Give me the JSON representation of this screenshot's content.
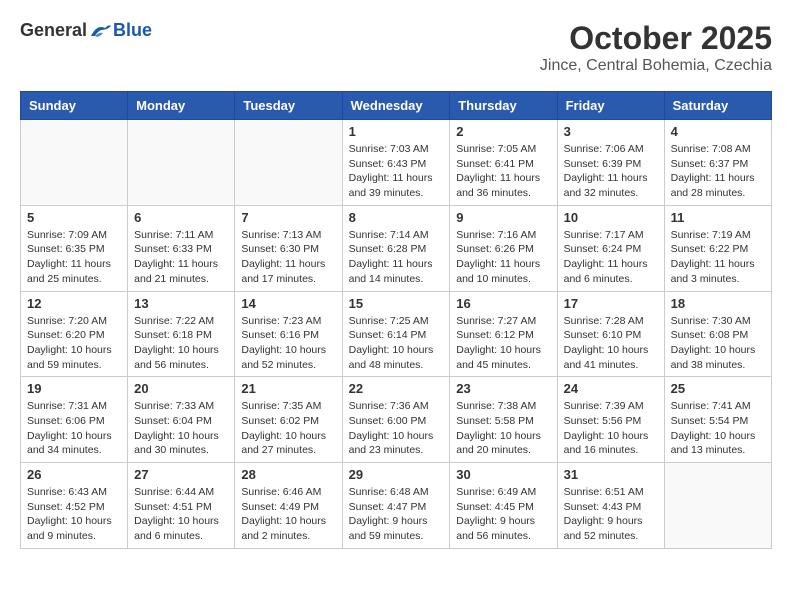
{
  "logo": {
    "general": "General",
    "blue": "Blue"
  },
  "title": "October 2025",
  "location": "Jince, Central Bohemia, Czechia",
  "days_of_week": [
    "Sunday",
    "Monday",
    "Tuesday",
    "Wednesday",
    "Thursday",
    "Friday",
    "Saturday"
  ],
  "weeks": [
    [
      {
        "day": "",
        "info": ""
      },
      {
        "day": "",
        "info": ""
      },
      {
        "day": "",
        "info": ""
      },
      {
        "day": "1",
        "info": "Sunrise: 7:03 AM\nSunset: 6:43 PM\nDaylight: 11 hours and 39 minutes."
      },
      {
        "day": "2",
        "info": "Sunrise: 7:05 AM\nSunset: 6:41 PM\nDaylight: 11 hours and 36 minutes."
      },
      {
        "day": "3",
        "info": "Sunrise: 7:06 AM\nSunset: 6:39 PM\nDaylight: 11 hours and 32 minutes."
      },
      {
        "day": "4",
        "info": "Sunrise: 7:08 AM\nSunset: 6:37 PM\nDaylight: 11 hours and 28 minutes."
      }
    ],
    [
      {
        "day": "5",
        "info": "Sunrise: 7:09 AM\nSunset: 6:35 PM\nDaylight: 11 hours and 25 minutes."
      },
      {
        "day": "6",
        "info": "Sunrise: 7:11 AM\nSunset: 6:33 PM\nDaylight: 11 hours and 21 minutes."
      },
      {
        "day": "7",
        "info": "Sunrise: 7:13 AM\nSunset: 6:30 PM\nDaylight: 11 hours and 17 minutes."
      },
      {
        "day": "8",
        "info": "Sunrise: 7:14 AM\nSunset: 6:28 PM\nDaylight: 11 hours and 14 minutes."
      },
      {
        "day": "9",
        "info": "Sunrise: 7:16 AM\nSunset: 6:26 PM\nDaylight: 11 hours and 10 minutes."
      },
      {
        "day": "10",
        "info": "Sunrise: 7:17 AM\nSunset: 6:24 PM\nDaylight: 11 hours and 6 minutes."
      },
      {
        "day": "11",
        "info": "Sunrise: 7:19 AM\nSunset: 6:22 PM\nDaylight: 11 hours and 3 minutes."
      }
    ],
    [
      {
        "day": "12",
        "info": "Sunrise: 7:20 AM\nSunset: 6:20 PM\nDaylight: 10 hours and 59 minutes."
      },
      {
        "day": "13",
        "info": "Sunrise: 7:22 AM\nSunset: 6:18 PM\nDaylight: 10 hours and 56 minutes."
      },
      {
        "day": "14",
        "info": "Sunrise: 7:23 AM\nSunset: 6:16 PM\nDaylight: 10 hours and 52 minutes."
      },
      {
        "day": "15",
        "info": "Sunrise: 7:25 AM\nSunset: 6:14 PM\nDaylight: 10 hours and 48 minutes."
      },
      {
        "day": "16",
        "info": "Sunrise: 7:27 AM\nSunset: 6:12 PM\nDaylight: 10 hours and 45 minutes."
      },
      {
        "day": "17",
        "info": "Sunrise: 7:28 AM\nSunset: 6:10 PM\nDaylight: 10 hours and 41 minutes."
      },
      {
        "day": "18",
        "info": "Sunrise: 7:30 AM\nSunset: 6:08 PM\nDaylight: 10 hours and 38 minutes."
      }
    ],
    [
      {
        "day": "19",
        "info": "Sunrise: 7:31 AM\nSunset: 6:06 PM\nDaylight: 10 hours and 34 minutes."
      },
      {
        "day": "20",
        "info": "Sunrise: 7:33 AM\nSunset: 6:04 PM\nDaylight: 10 hours and 30 minutes."
      },
      {
        "day": "21",
        "info": "Sunrise: 7:35 AM\nSunset: 6:02 PM\nDaylight: 10 hours and 27 minutes."
      },
      {
        "day": "22",
        "info": "Sunrise: 7:36 AM\nSunset: 6:00 PM\nDaylight: 10 hours and 23 minutes."
      },
      {
        "day": "23",
        "info": "Sunrise: 7:38 AM\nSunset: 5:58 PM\nDaylight: 10 hours and 20 minutes."
      },
      {
        "day": "24",
        "info": "Sunrise: 7:39 AM\nSunset: 5:56 PM\nDaylight: 10 hours and 16 minutes."
      },
      {
        "day": "25",
        "info": "Sunrise: 7:41 AM\nSunset: 5:54 PM\nDaylight: 10 hours and 13 minutes."
      }
    ],
    [
      {
        "day": "26",
        "info": "Sunrise: 6:43 AM\nSunset: 4:52 PM\nDaylight: 10 hours and 9 minutes."
      },
      {
        "day": "27",
        "info": "Sunrise: 6:44 AM\nSunset: 4:51 PM\nDaylight: 10 hours and 6 minutes."
      },
      {
        "day": "28",
        "info": "Sunrise: 6:46 AM\nSunset: 4:49 PM\nDaylight: 10 hours and 2 minutes."
      },
      {
        "day": "29",
        "info": "Sunrise: 6:48 AM\nSunset: 4:47 PM\nDaylight: 9 hours and 59 minutes."
      },
      {
        "day": "30",
        "info": "Sunrise: 6:49 AM\nSunset: 4:45 PM\nDaylight: 9 hours and 56 minutes."
      },
      {
        "day": "31",
        "info": "Sunrise: 6:51 AM\nSunset: 4:43 PM\nDaylight: 9 hours and 52 minutes."
      },
      {
        "day": "",
        "info": ""
      }
    ]
  ]
}
